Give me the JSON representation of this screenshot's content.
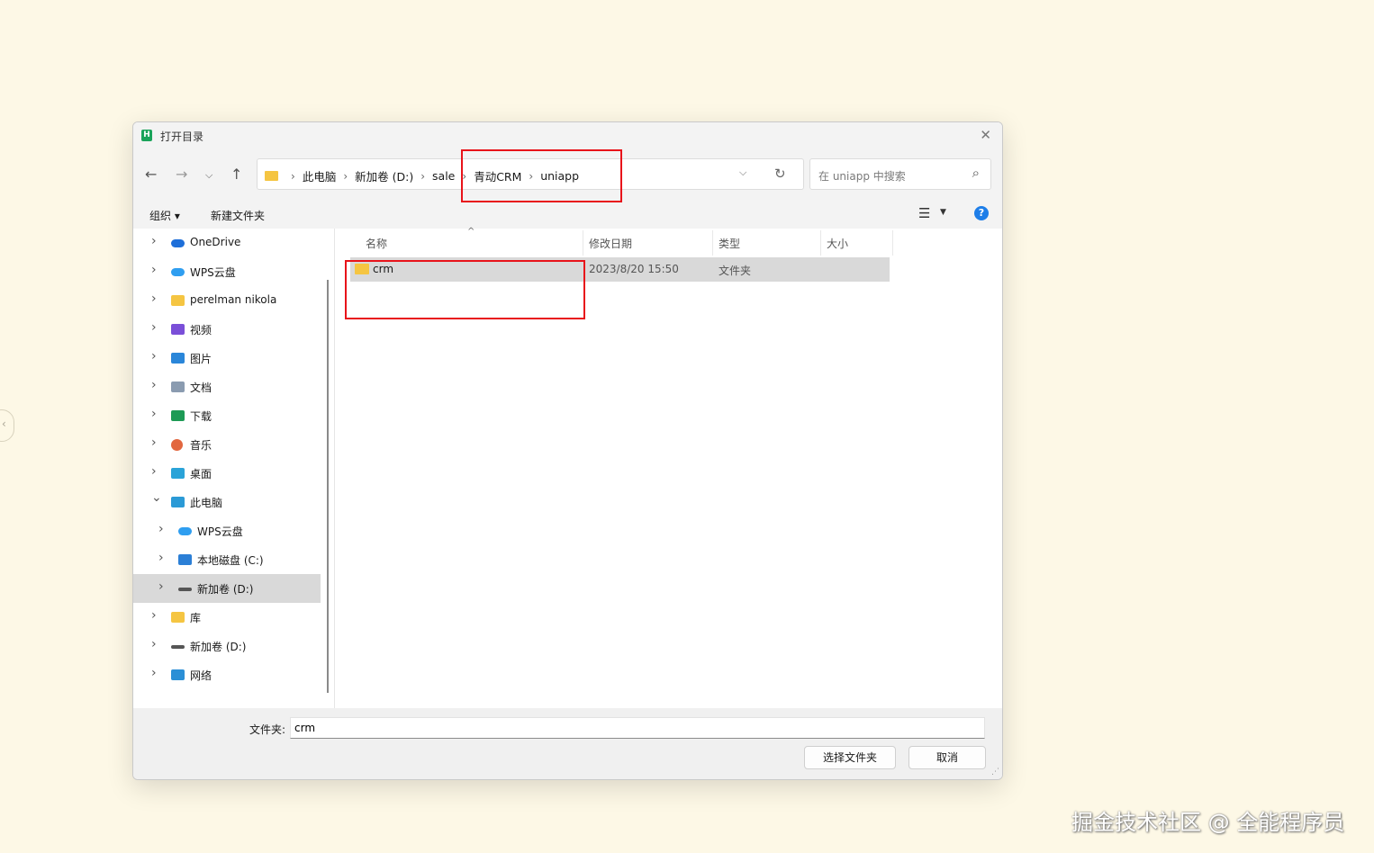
{
  "window": {
    "title": "打开目录",
    "close_label": "✕"
  },
  "nav": {
    "breadcrumbs": [
      "此电脑",
      "新加卷 (D:)",
      "sale",
      "青动CRM",
      "uniapp"
    ],
    "search_placeholder": "在 uniapp 中搜索"
  },
  "toolbar": {
    "organize": "组织 ▾",
    "new_folder": "新建文件夹"
  },
  "sidebar": {
    "items": [
      {
        "label": "OneDrive",
        "icon": "cloud-icon",
        "color": "#1e6fd9",
        "expanded": false
      },
      {
        "label": "WPS云盘",
        "icon": "cloud-icon",
        "color": "#2f9ef0",
        "expanded": false
      },
      {
        "label": "perelman nikola",
        "icon": "folder-icon",
        "color": "#f5c542",
        "expanded": false
      },
      {
        "label": "视频",
        "icon": "video-icon",
        "color": "#7a4fd8",
        "expanded": false
      },
      {
        "label": "图片",
        "icon": "picture-icon",
        "color": "#2a86d9",
        "expanded": false
      },
      {
        "label": "文档",
        "icon": "document-icon",
        "color": "#8a9bb0",
        "expanded": false
      },
      {
        "label": "下载",
        "icon": "download-icon",
        "color": "#1d9a55",
        "expanded": false
      },
      {
        "label": "音乐",
        "icon": "music-icon",
        "color": "#e2673f",
        "expanded": false
      },
      {
        "label": "桌面",
        "icon": "desktop-icon",
        "color": "#2aa3d8",
        "expanded": false
      },
      {
        "label": "此电脑",
        "icon": "computer-icon",
        "color": "#2b9ad6",
        "expanded": true
      },
      {
        "label": "WPS云盘",
        "icon": "cloud-icon",
        "color": "#2f9ef0",
        "expanded": false
      },
      {
        "label": "本地磁盘 (C:)",
        "icon": "windows-drive-icon",
        "color": "#2b7fd6",
        "expanded": false
      },
      {
        "label": "新加卷 (D:)",
        "icon": "drive-icon",
        "color": "#555555",
        "expanded": false,
        "selected": true
      },
      {
        "label": "库",
        "icon": "library-icon",
        "color": "#f5c542",
        "expanded": false
      },
      {
        "label": "新加卷 (D:)",
        "icon": "drive-icon",
        "color": "#555555",
        "expanded": false
      },
      {
        "label": "网络",
        "icon": "network-icon",
        "color": "#2b8fd6",
        "expanded": false
      }
    ]
  },
  "file_list": {
    "columns": [
      "名称",
      "修改日期",
      "类型",
      "大小"
    ],
    "rows": [
      {
        "name": "crm",
        "modified": "2023/8/20 15:50",
        "type": "文件夹",
        "size": ""
      }
    ]
  },
  "bottom": {
    "folder_label": "文件夹:",
    "folder_value": "crm",
    "select_button": "选择文件夹",
    "cancel_button": "取消"
  },
  "watermark": "掘金技术社区 @ 全能程序员",
  "colors": {
    "highlight_box": "#e8131a",
    "background": "#fdf8e6"
  }
}
